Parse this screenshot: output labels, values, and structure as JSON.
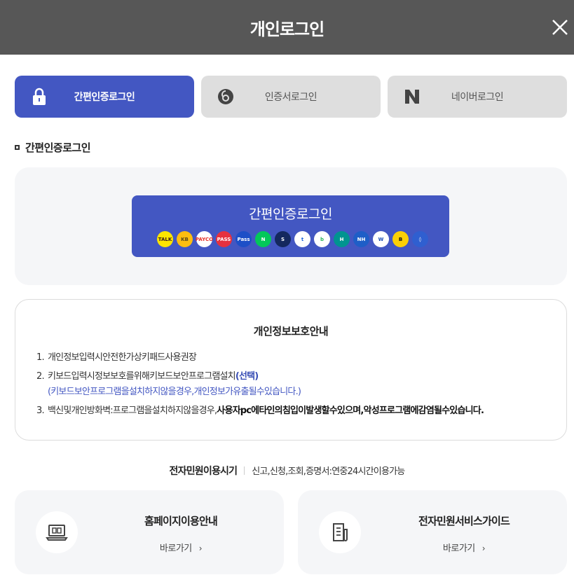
{
  "header": {
    "title": "개인로그인"
  },
  "tabs": [
    {
      "label": "간편인증로그인",
      "icon": "lock-icon",
      "active": true
    },
    {
      "label": "인증서로그인",
      "icon": "certificate-icon",
      "active": false
    },
    {
      "label": "네이버로그인",
      "icon": "naver-icon",
      "active": false
    }
  ],
  "section": {
    "title": "간편인증로그인"
  },
  "simple_login": {
    "button_label": "간편인증로그인",
    "providers": [
      {
        "name": "kakao",
        "text": "TALK",
        "bg": "#fde500",
        "fg": "#3a1d1d"
      },
      {
        "name": "kb",
        "text": "KB",
        "bg": "#fdbe10",
        "fg": "#5a4a1a"
      },
      {
        "name": "payco",
        "text": "PAYCO",
        "bg": "#ffffff",
        "fg": "#e4322b"
      },
      {
        "name": "pass",
        "text": "PASS",
        "bg": "#e5313f",
        "fg": "#ffffff"
      },
      {
        "name": "samsung-pass",
        "text": "Pass",
        "bg": "#1d4fc7",
        "fg": "#ffffff"
      },
      {
        "name": "naver",
        "text": "N",
        "bg": "#03c75a",
        "fg": "#ffffff"
      },
      {
        "name": "shinhan",
        "text": "S",
        "bg": "#14285e",
        "fg": "#ffffff"
      },
      {
        "name": "toss",
        "text": "t",
        "bg": "#ffffff",
        "fg": "#1b64da"
      },
      {
        "name": "banksalad",
        "text": "b",
        "bg": "#ffffff",
        "fg": "#2ab55c"
      },
      {
        "name": "hana",
        "text": "H",
        "bg": "#009490",
        "fg": "#ffffff"
      },
      {
        "name": "nh",
        "text": "NH",
        "bg": "#1e5ec7",
        "fg": "#ffffff"
      },
      {
        "name": "woori",
        "text": "W",
        "bg": "#ffffff",
        "fg": "#1b4db5"
      },
      {
        "name": "kbank",
        "text": "B",
        "bg": "#fbd005",
        "fg": "#111111"
      },
      {
        "name": "security",
        "text": "◊",
        "bg": "#2f5fd0",
        "fg": "#ffffff"
      }
    ]
  },
  "privacy": {
    "title": "개인정보보호안내",
    "items": [
      {
        "num": "1.",
        "text": "개인정보입력시안전한가상키패드사용권장"
      },
      {
        "num": "2.",
        "text": "키보드입력시정보보호를위해키보드보안프로그램설치",
        "highlight": "(선택)",
        "sub": "(키보드보안프로그램을설치하지않을경우,개인정보가유출될수있습니다.)"
      },
      {
        "num": "3.",
        "text": "백신및개인방화벽:프로그램을설치하지않을경우,",
        "strong": "사용자pc에타인의침입이발생할수있으며,악성프로그램에감염될수있습니다."
      }
    ]
  },
  "service_time": {
    "label": "전자민원이용시기",
    "value": "신고,신청,조회,증명서:연중24시간이용가능"
  },
  "cards": [
    {
      "title": "홈페이지이용안내",
      "link": "바로가기",
      "arrow": "›",
      "icon": "monitor-icon"
    },
    {
      "title": "전자민원서비스가이드",
      "link": "바로가기",
      "arrow": "›",
      "icon": "document-icon"
    }
  ],
  "colors": {
    "header_bg": "#575757",
    "accent": "#4357c2",
    "tab_inactive": "#dedede",
    "panel_bg": "#f5f6f8"
  }
}
